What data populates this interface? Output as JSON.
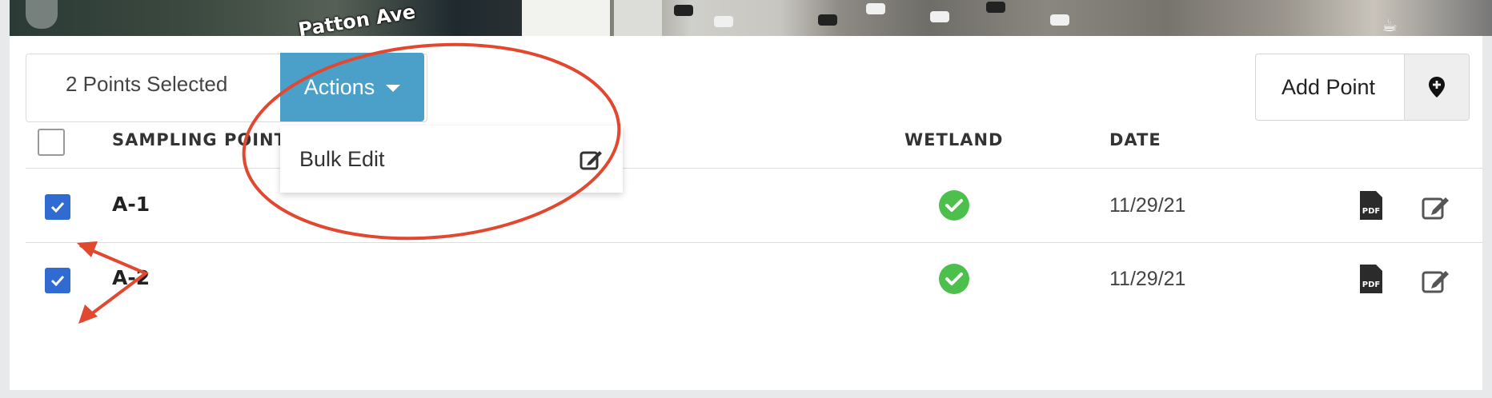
{
  "map": {
    "street_label": "Patton Ave"
  },
  "toolbar": {
    "selected_text": "2 Points Selected",
    "actions_label": "Actions",
    "add_point_label": "Add Point"
  },
  "dropdown": {
    "items": [
      {
        "label": "Bulk Edit",
        "icon": "edit-icon"
      }
    ]
  },
  "table": {
    "headers": {
      "sampling_point": "SAMPLING POINT",
      "wetland": "WETLAND",
      "date": "DATE"
    },
    "rows": [
      {
        "name": "A-1",
        "wetland": true,
        "date": "11/29/21",
        "checked": true
      },
      {
        "name": "A-2",
        "wetland": true,
        "date": "11/29/21",
        "checked": true
      }
    ]
  },
  "colors": {
    "actions_bg": "#4aa0c8",
    "checkbox_checked": "#2f6bd0",
    "wetland_check": "#4cbf4c",
    "annotation_red": "#e2472f"
  }
}
